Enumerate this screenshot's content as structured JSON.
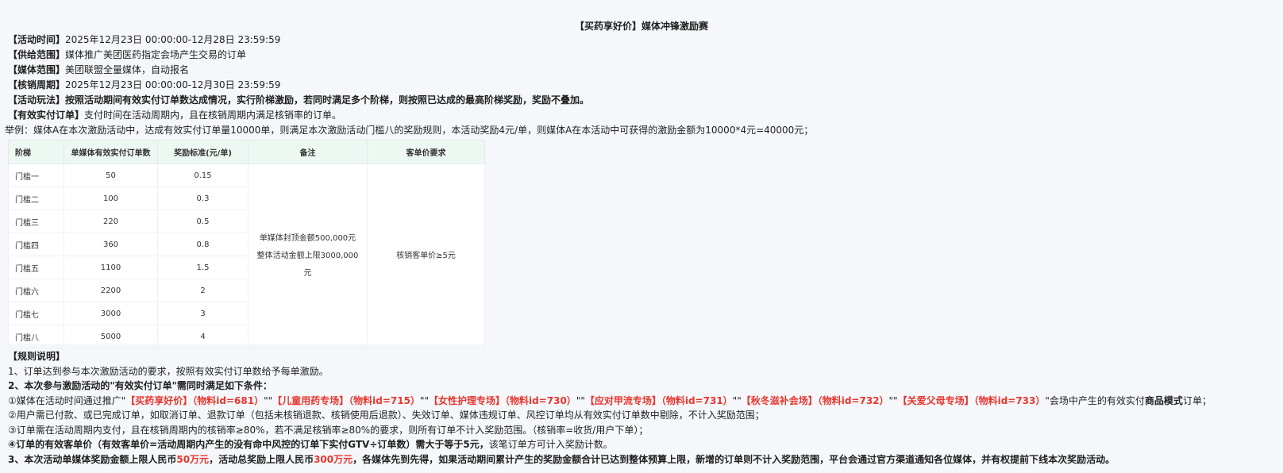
{
  "title": "【买药享好价】媒体冲锋激励赛",
  "info": [
    {
      "label": "【活动时间】",
      "text": "2025年12月23日 00:00:00-12月28日 23:59:59"
    },
    {
      "label": "【供给范围】",
      "text": "媒体推广美团医药指定会场产生交易的订单"
    },
    {
      "label": "【媒体范围】",
      "text": "美团联盟全量媒体，自动报名"
    },
    {
      "label": "【核销周期】",
      "text": "2025年12月23日 00:00:00-12月30日 23:59:59"
    },
    {
      "label": "【活动玩法】",
      "text": "按照活动期间有效实付订单数达成情况，实行阶梯激励，若同时满足多个阶梯，则按照已达成的最高阶梯奖励，奖励不叠加。"
    },
    {
      "label": "【有效实付订单】",
      "text": "支付时间在活动周期内，且在核销周期内满足核销率的订单。"
    }
  ],
  "example": "举例：媒体A在本次激励活动中，达成有效实付订单量10000单，则满足本次激励活动门槛八的奖励规则，本活动奖励4元/单，则媒体A在本活动中可获得的激励金额为10000*4元=40000元；",
  "table": {
    "headers": [
      "阶梯",
      "单媒体有效实付订单数",
      "奖励标准(元/单)",
      "备注",
      "客单价要求"
    ],
    "rows": [
      {
        "tier": "门槛一",
        "orders": "50",
        "reward": "0.15"
      },
      {
        "tier": "门槛二",
        "orders": "100",
        "reward": "0.3"
      },
      {
        "tier": "门槛三",
        "orders": "220",
        "reward": "0.5"
      },
      {
        "tier": "门槛四",
        "orders": "360",
        "reward": "0.8"
      },
      {
        "tier": "门槛五",
        "orders": "1100",
        "reward": "1.5"
      },
      {
        "tier": "门槛六",
        "orders": "2200",
        "reward": "2"
      },
      {
        "tier": "门槛七",
        "orders": "3000",
        "reward": "3"
      },
      {
        "tier": "门槛八",
        "orders": "5000",
        "reward": "4"
      }
    ],
    "note_line1": "单媒体封顶金额500,000元",
    "note_line2": "整体活动金额上限3000,000元",
    "price_requirement": "核销客单价≥5元"
  },
  "rules": {
    "heading": "【规则说明】",
    "r1": "1、订单达到参与本次激励活动的要求，按照有效实付订单数给予每单激励。",
    "r2": "2、本次参与激励活动的\"有效实付订单\"需同时满足如下条件：",
    "r2a_prefix": "①媒体在活动时间通过推广\"",
    "r2a_venues": [
      "【买药享好价】（物料id=681）",
      "【儿童用药专场】（物料id=715）",
      "【女性护理专场】（物料id=730）",
      "【应对甲流专场】（物料id=731）",
      "【秋冬滋补会场】（物料id=732）",
      "【关爱父母专场】（物料id=733）"
    ],
    "r2a_sep": "\"\"",
    "r2a_suffix_plain": "\"会场中产生的有效实付",
    "r2a_suffix_bold": "商品模式",
    "r2a_suffix_end": "订单；",
    "r2b": "②用户需已付款、或已完成订单，如取消订单、退款订单（包括未核销退款、核销使用后退款）、失效订单、媒体违规订单、风控订单均从有效实付订单数中剔除，不计入奖励范围；",
    "r2c": "③订单需在活动周期内支付，且在核销周期内的核销率≥80%，若不满足核销率≥80%的要求，则所有订单不计入奖励范围。（核销率=收货/用户下单）；",
    "r2d_bold": "④订单的有效客单价（有效客单价=活动周期内产生的没有命中风控的订单下实付GTV÷订单数）需大于等于5元，",
    "r2d_plain": "该笔订单方可计入奖励计数。",
    "r3_a": "3、本次活动单媒体奖励金额上限人民币",
    "r3_b": "50万元",
    "r3_c": "，活动总奖励上限人民币",
    "r3_d": "300万元",
    "r3_e": "，各媒体先到先得，如果活动期间累计产生的奖励金额合计已达到整体预算上限，新增的订单则不计入奖励范围，平台会通过官方渠道通知各位媒体，并有权提前下线本次奖励活动。"
  }
}
